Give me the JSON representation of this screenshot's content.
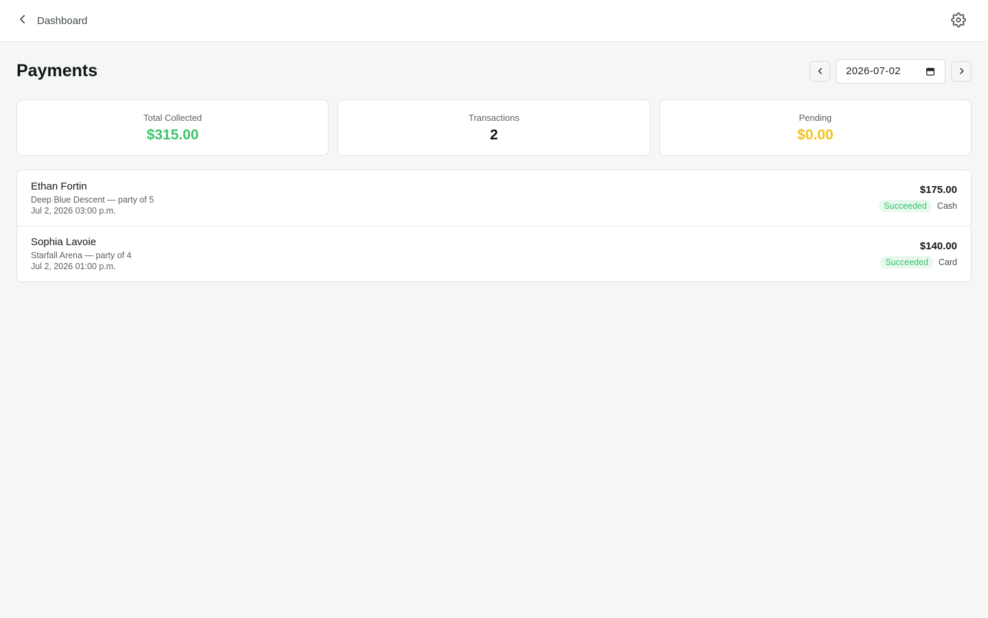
{
  "topbar": {
    "back_label": "Dashboard",
    "settings_icon": "gear-icon"
  },
  "page": {
    "title": "Payments",
    "date_value": "2026-07-02"
  },
  "colors": {
    "success": "#34c46a",
    "pending": "#f2c21b",
    "neutral": "#111614"
  },
  "stats": [
    {
      "label": "Total Collected",
      "value": "$315.00",
      "color": "#3ec46d"
    },
    {
      "label": "Transactions",
      "value": "2",
      "color": "#111614"
    },
    {
      "label": "Pending",
      "value": "$0.00",
      "color": "#f2c21b"
    }
  ],
  "payments": [
    {
      "customer": "Ethan Fortin",
      "booking": "Deep Blue Descent — party of 5",
      "datetime": "Jul 2, 2026 03:00 p.m.",
      "amount": "$175.00",
      "status": "Succeeded",
      "method": "Cash"
    },
    {
      "customer": "Sophia Lavoie",
      "booking": "Starfall Arena — party of 4",
      "datetime": "Jul 2, 2026 01:00 p.m.",
      "amount": "$140.00",
      "status": "Succeeded",
      "method": "Card"
    }
  ]
}
